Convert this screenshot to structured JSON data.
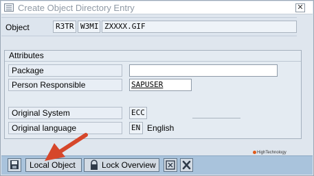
{
  "window": {
    "title": "Create Object Directory Entry",
    "close_symbol": "✕"
  },
  "object_row": {
    "label": "Object",
    "pgmid": "R3TR",
    "object_type": "W3MI",
    "object_name": "ZXXXX.GIF"
  },
  "attributes": {
    "group_title": "Attributes",
    "package_label": "Package",
    "package_value": "",
    "person_label": "Person Responsible",
    "person_value": "SAPUSER",
    "system_label": "Original System",
    "system_value": "ECC",
    "language_label": "Original language",
    "language_code": "EN",
    "language_name": "English"
  },
  "brand": {
    "text": "HighTechnology"
  },
  "toolbar": {
    "local_object_label": "Local Object",
    "lock_overview_label": "Lock Overview"
  },
  "icons": [
    "window-icon",
    "close-icon",
    "save-icon",
    "lock-icon",
    "move-icon",
    "cancel-icon",
    "arrow-annotation"
  ],
  "colors": {
    "arrow": "#d6472b",
    "toolbar": "#a9c3dc",
    "cancel_x": "#c0392b"
  }
}
